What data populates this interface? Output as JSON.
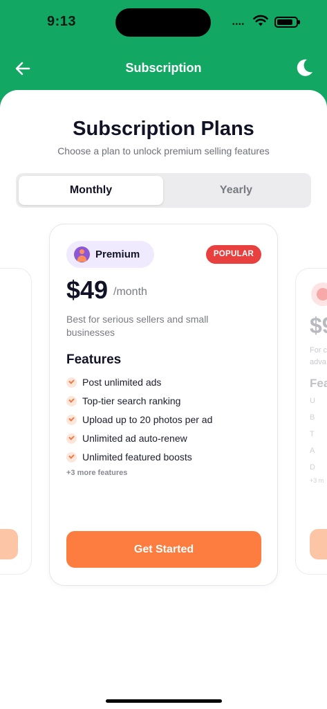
{
  "status_bar": {
    "time": "9:13",
    "dots": "••••"
  },
  "header": {
    "title": "Subscription",
    "back_icon": "arrow-left-icon",
    "theme_icon": "moon-icon"
  },
  "page": {
    "title": "Subscription Plans",
    "subtitle": "Choose a plan to unlock premium selling features"
  },
  "billing_toggle": {
    "options": [
      "Monthly",
      "Yearly"
    ],
    "selected": "Monthly"
  },
  "plan": {
    "name": "Premium",
    "badge": "POPULAR",
    "price": "$49",
    "period": "/month",
    "description": "Best for serious sellers and small businesses",
    "features_heading": "Features",
    "features": [
      "Post unlimited ads",
      "Top-tier search ranking",
      "Upload up to 20 photos per ad",
      "Unlimited ad auto-renew",
      "Unlimited featured boosts"
    ],
    "more_features": "+3 more features",
    "cta_label": "Get Started"
  },
  "right_card_partial": {
    "price": "$9",
    "desc_line1": "For c",
    "desc_line2": "adva",
    "features_heading": "Fea",
    "features": [
      "U",
      "B",
      "T",
      "A",
      "D"
    ],
    "more": "+3 m"
  },
  "colors": {
    "brand_green": "#12a763",
    "accent_orange": "#fc7d3f",
    "popular_red": "#e8403f",
    "badge_lavender": "#efeafe"
  }
}
